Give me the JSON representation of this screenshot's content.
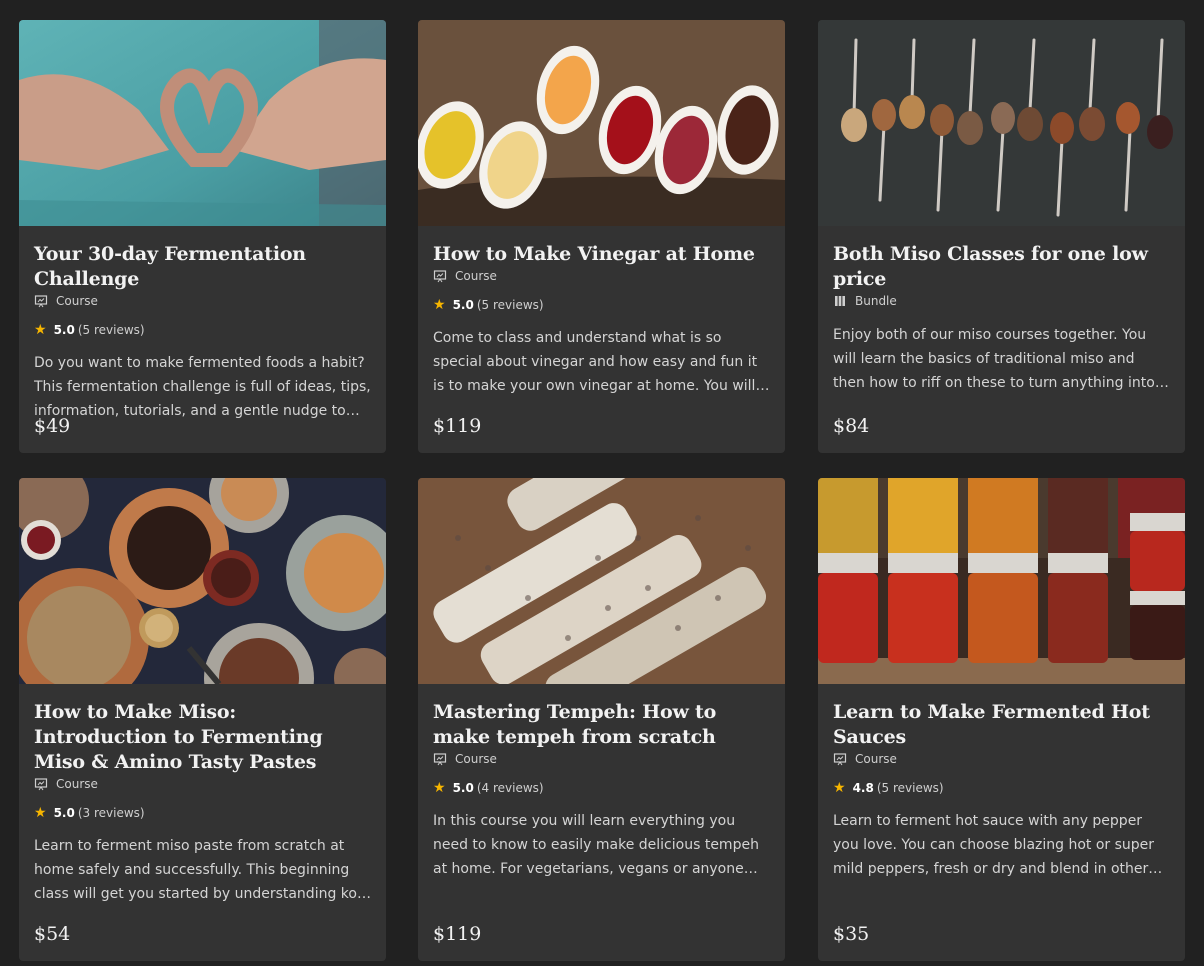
{
  "courses": [
    {
      "title": "Your 30-day Fermentation Challenge",
      "type": "Course",
      "type_icon": "presentation-icon",
      "rating": "5.0",
      "reviews": "(5 reviews)",
      "description": "Do you want to make fermented foods a habit? This fermentation challenge is full of ideas, tips, information, tutorials, and a gentle nudge to make fermenting a regular habit.",
      "price": "$49",
      "image": "heart-hands-photo"
    },
    {
      "title": "How to Make Vinegar at Home",
      "type": "Course",
      "type_icon": "presentation-icon",
      "rating": "5.0",
      "reviews": "(5 reviews)",
      "description": "Come to class and understand what is so special about vinegar and how easy and fun it is to make your own vinegar at home. You will never look at vinegar the same way again.",
      "price": "$119",
      "image": "vinegar-bowls-photo"
    },
    {
      "title": "Both Miso Classes for one low price",
      "type": "Bundle",
      "type_icon": "bundle-icon",
      "description": "Enjoy both of our miso courses together. You will learn the basics of traditional miso and then how to riff on these to turn anything into a delicious paste.",
      "price": "$84",
      "image": "miso-spoons-photo"
    },
    {
      "title": "How to Make Miso: Introduction to Fermenting Miso & Amino Tasty Pastes",
      "type": "Course",
      "type_icon": "presentation-icon",
      "rating": "5.0",
      "reviews": "(3 reviews)",
      "description": "Learn to ferment miso paste from scratch at home safely and successfully. This beginning class will get you started by understanding koji and everything you need to know.",
      "price": "$54",
      "image": "miso-bowls-photo"
    },
    {
      "title": "Mastering Tempeh: How to make tempeh from scratch",
      "type": "Course",
      "type_icon": "presentation-icon",
      "rating": "5.0",
      "reviews": "(4 reviews)",
      "description": "In this course you will learn everything you need to know to easily make delicious tempeh at home. For vegetarians, vegans or anyone looking to eat a healthier diet.",
      "price": "$119",
      "image": "tempeh-photo"
    },
    {
      "title": "Learn to Make Fermented Hot Sauces",
      "type": "Course",
      "type_icon": "presentation-icon",
      "rating": "4.8",
      "reviews": "(5 reviews)",
      "description": "Learn to ferment hot sauce with any pepper you love. You can choose blazing hot or super mild peppers, fresh or dry and blend in other flavors. The possibilities are endless.",
      "price": "$35",
      "image": "hot-sauce-jars-photo"
    }
  ],
  "colors": {
    "background": "#212121",
    "card": "#333333",
    "star": "#f6b500"
  }
}
